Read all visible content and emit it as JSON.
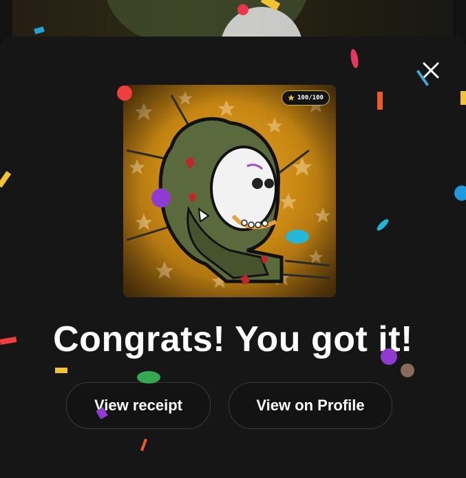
{
  "modal": {
    "close_icon": "close-icon",
    "headline": "Congrats! You got it!",
    "nft": {
      "badge_icon": "star-icon",
      "badge_text": "100/100"
    },
    "actions": {
      "view_receipt": "View receipt",
      "view_profile": "View on Profile"
    }
  },
  "colors": {
    "modal_bg": "#161617",
    "button_border": "#3a3a3d",
    "badge_border": "#c9b84a",
    "art_background": "#c98812"
  }
}
